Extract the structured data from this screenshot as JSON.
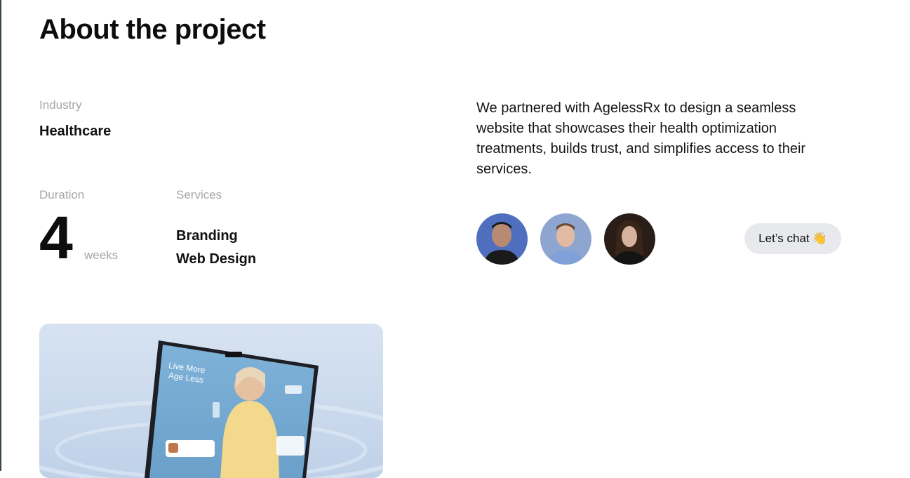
{
  "header": {
    "title": "About the project"
  },
  "details": {
    "industry_label": "Industry",
    "industry_value": "Healthcare",
    "duration_label": "Duration",
    "duration_value": "4",
    "duration_unit": "weeks",
    "services_label": "Services",
    "services": [
      "Branding",
      "Web Design"
    ]
  },
  "description": "We partnered with AgelessRx to design a seamless website that showcases their health optimization treatments, builds trust, and simplifies access to their services.",
  "team": {
    "avatars": [
      "avatar-1",
      "avatar-2",
      "avatar-3"
    ]
  },
  "cta": {
    "label": "Let’s chat",
    "icon": "waving-hand-icon",
    "emoji": "👋"
  },
  "hero": {
    "headline_line1": "Live More",
    "headline_line2": "Age Less"
  },
  "colors": {
    "cta_bg": "#e7e9ec",
    "muted_text": "#a6a6a6",
    "hero_bg": "#cfdcee"
  }
}
